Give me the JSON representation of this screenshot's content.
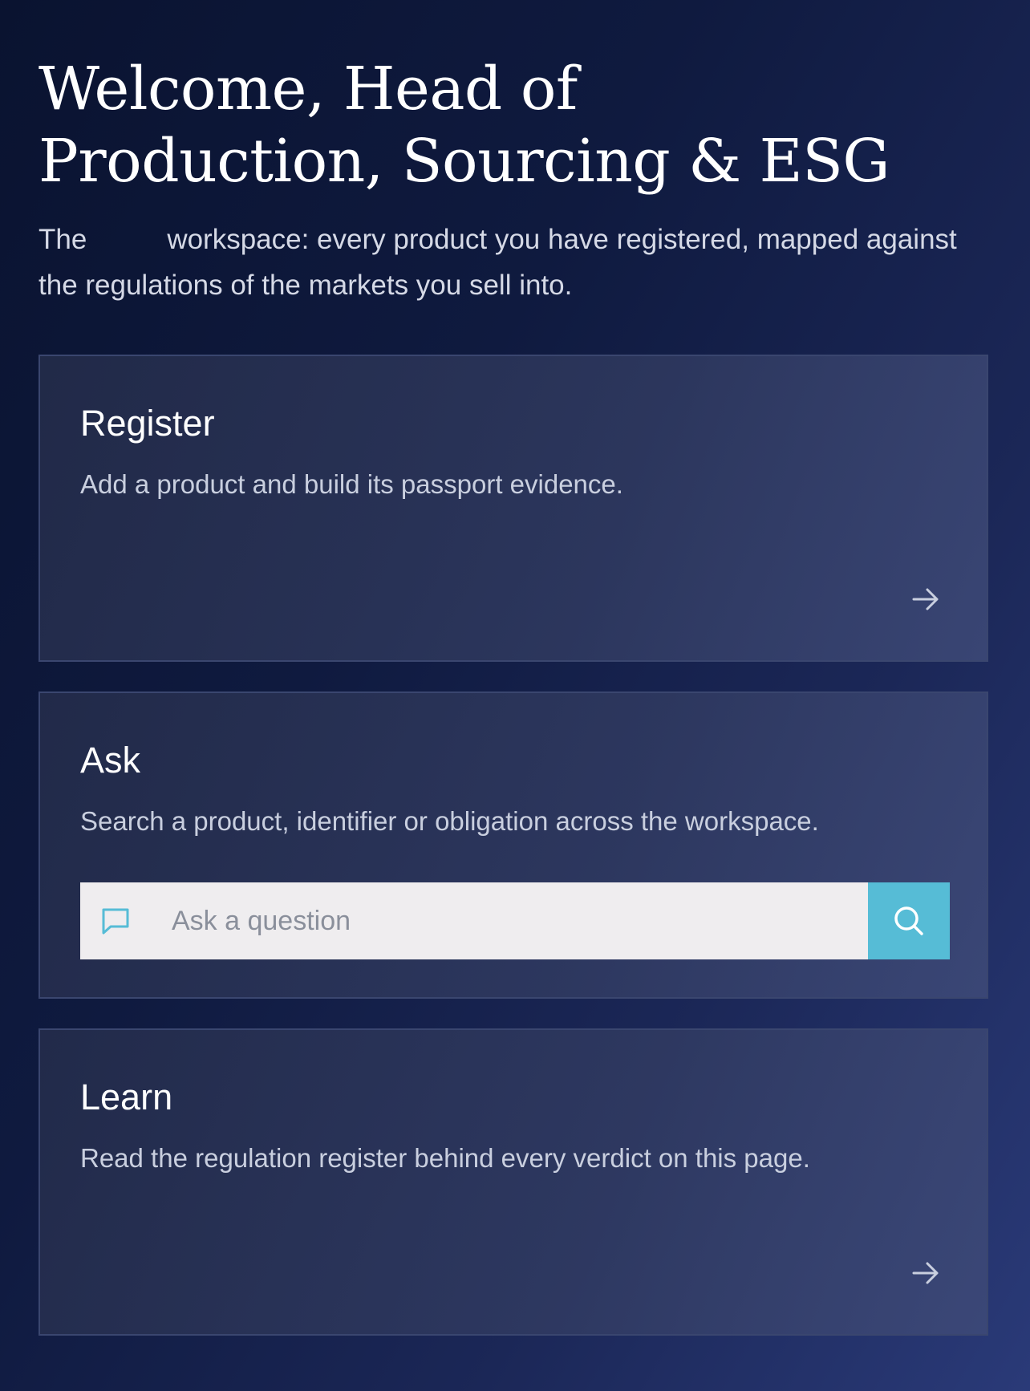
{
  "header": {
    "title": "Welcome, Head of Production, Sourcing & ESG",
    "subtitle_prefix": "The",
    "subtitle_rest": "workspace: every product you have registered, mapped against the regulations of the markets you sell into."
  },
  "cards": {
    "register": {
      "title": "Register",
      "description": "Add a product and build its passport evidence.",
      "action_icon": "arrow-right-icon"
    },
    "ask": {
      "title": "Ask",
      "description": "Search a product, identifier or obligation across the workspace.",
      "input_placeholder": "Ask a question",
      "input_value": "",
      "field_icon": "chat-bubble-icon",
      "button_icon": "search-icon"
    },
    "learn": {
      "title": "Learn",
      "description": "Read the regulation register behind every verdict on this page.",
      "action_icon": "arrow-right-icon"
    }
  },
  "colors": {
    "accent": "#56bcd6",
    "card_border": "#3a466f",
    "input_bg": "#efedef",
    "background_dark": "#0a1330",
    "background_light": "#2a3a78"
  }
}
